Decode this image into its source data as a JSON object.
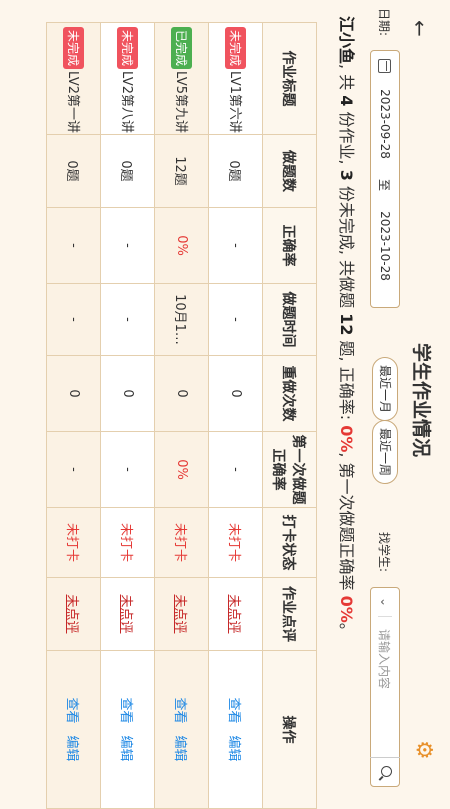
{
  "header": {
    "title": "学生作业情况",
    "back_icon": "arrow-left-icon",
    "settings_icon": "gear-icon"
  },
  "filter": {
    "date_label": "日期:",
    "date_start": "2023-09-28",
    "date_sep": "至",
    "date_end": "2023-10-28",
    "btn_month": "最近一月",
    "btn_week": "最近一周",
    "student_label": "找学生:",
    "student_placeholder": "请输入内容"
  },
  "summary": {
    "name": "江小鱼",
    "t1": ", 共 ",
    "total": "4",
    "t2": " 份作业, ",
    "unfinished": "3",
    "t3": " 份未完成, 共做题 ",
    "questions": "12",
    "t4": " 题, 正确率: ",
    "accuracy": "0%",
    "t5": ", 第一次做题正确率 ",
    "first_accuracy": "0%",
    "t6": "。"
  },
  "table": {
    "headers": [
      "作业标题",
      "做题数",
      "正确率",
      "做题时间",
      "重做次数",
      "第一次做题正确率",
      "打卡状态",
      "作业点评",
      "操作"
    ],
    "rows": [
      {
        "badge": "未完成",
        "badge_color": "#f0535e",
        "title": "LV1第六讲…",
        "count": "0题",
        "accuracy": "-",
        "time": "-",
        "redo": "0",
        "first": "-",
        "checkin": "未打卡",
        "review": "未点评",
        "view": "查看",
        "edit": "编辑"
      },
      {
        "badge": "已完成",
        "badge_color": "#4caf50",
        "title": "LV5第九讲…",
        "count": "12题",
        "accuracy": "0%",
        "time": "10月1…",
        "redo": "0",
        "first": "0%",
        "checkin": "未打卡",
        "review": "未点评",
        "view": "查看",
        "edit": "编辑"
      },
      {
        "badge": "未完成",
        "badge_color": "#f0535e",
        "title": "LV2第八讲…",
        "count": "0题",
        "accuracy": "-",
        "time": "-",
        "redo": "0",
        "first": "-",
        "checkin": "未打卡",
        "review": "未点评",
        "view": "查看",
        "edit": "编辑"
      },
      {
        "badge": "未完成",
        "badge_color": "#f0535e",
        "title": "LV2第一讲…",
        "count": "0题",
        "accuracy": "-",
        "time": "-",
        "redo": "0",
        "first": "-",
        "checkin": "未打卡",
        "review": "未点评",
        "view": "查看",
        "edit": "编辑"
      }
    ]
  }
}
